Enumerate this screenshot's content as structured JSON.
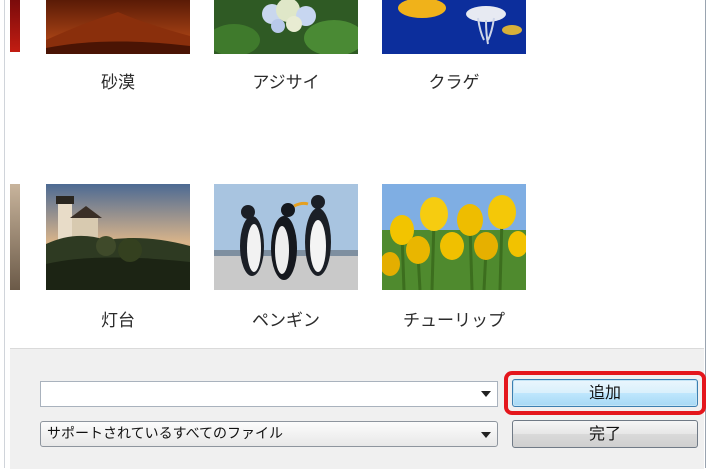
{
  "gallery": {
    "row1": [
      {
        "caption": "砂漠"
      },
      {
        "caption": "アジサイ"
      },
      {
        "caption": "クラゲ"
      }
    ],
    "row2": [
      {
        "caption": "灯台"
      },
      {
        "caption": "ペンギン"
      },
      {
        "caption": "チューリップ"
      }
    ]
  },
  "footer": {
    "filename_value": "",
    "filetype_selected": "サポートされているすべてのファイル",
    "add_label": "追加",
    "done_label": "完了"
  },
  "colors": {
    "highlight": "#e4161c",
    "accent_button": "#bee6fd"
  }
}
